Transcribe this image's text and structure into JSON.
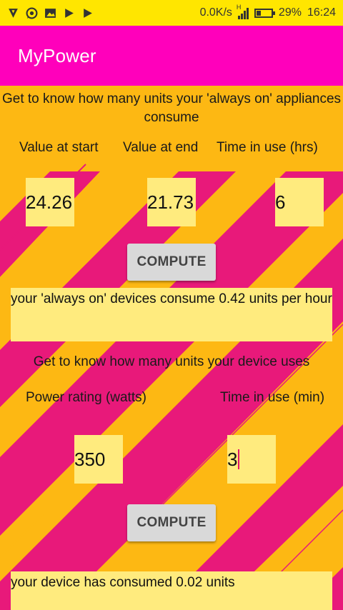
{
  "status_bar": {
    "net_speed": "0.0K/s",
    "signal_label": "H",
    "battery": "29%",
    "time": "16:24",
    "icons": [
      "vpn-icon",
      "whatsapp-icon",
      "gallery-icon",
      "play-store-icon",
      "play-store-icon"
    ]
  },
  "app": {
    "title": "MyPower"
  },
  "section1": {
    "heading": "Get to know how many units your 'always on' appliances consume",
    "labels": {
      "start": "Value at start",
      "end": "Value at end",
      "time": "Time in use (hrs)"
    },
    "values": {
      "start": "24.26",
      "end": "21.73",
      "time": "6"
    },
    "button": "COMPUTE",
    "result": "your 'always on' devices consume 0.42 units per hour"
  },
  "section2": {
    "heading": "Get to know how many units your device uses",
    "labels": {
      "power": "Power rating (watts)",
      "time": "Time in use (min)"
    },
    "values": {
      "power": "350",
      "time": "3"
    },
    "button": "COMPUTE",
    "result": "your device has consumed 0.02 units"
  },
  "colors": {
    "status_bar": "#FFE600",
    "app_bar": "#FF00BB",
    "background": "#FDB813",
    "stripe": "#E8197A",
    "field": "#FFEB7E"
  }
}
